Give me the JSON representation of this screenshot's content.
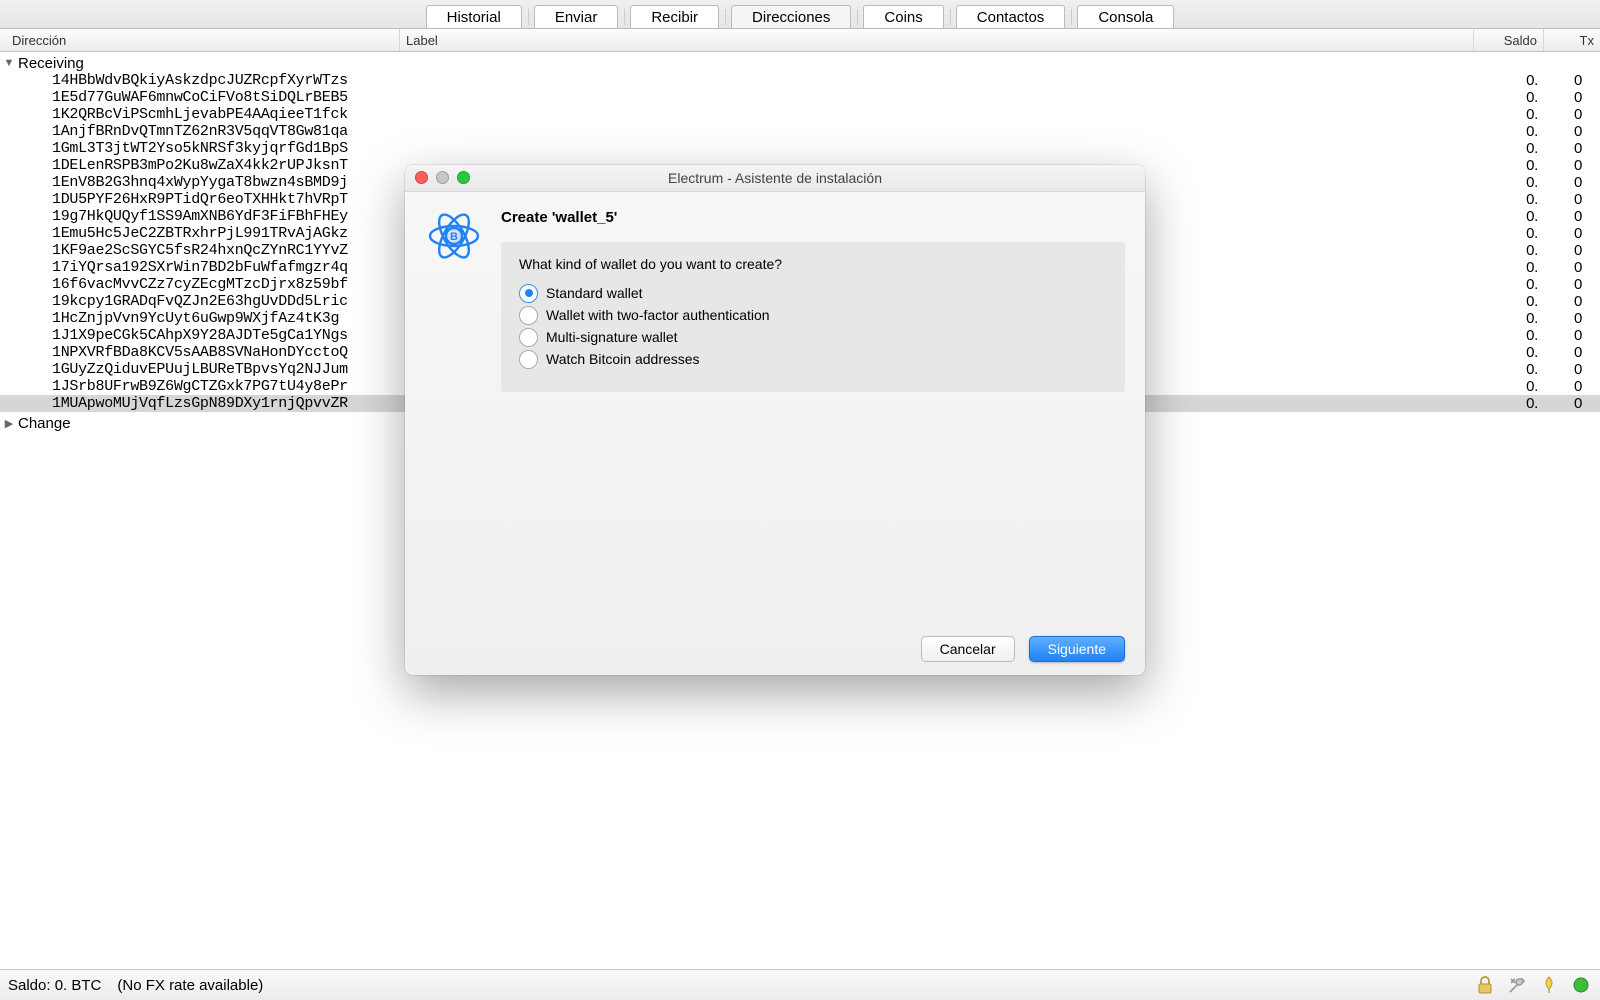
{
  "tabs": [
    "Historial",
    "Enviar",
    "Recibir",
    "Direcciones",
    "Coins",
    "Contactos",
    "Consola"
  ],
  "active_tab": 3,
  "columns": {
    "address": "Dirección",
    "label": "Label",
    "balance": "Saldo",
    "tx": "Tx"
  },
  "groups": [
    {
      "name": "Receiving",
      "expanded": true,
      "rows": [
        {
          "addr": "14HBbWdvBQkiyAskzdpcJUZRcpfXyrWTzs",
          "saldo": "0.",
          "tx": "0"
        },
        {
          "addr": "1E5d77GuWAF6mnwCoCiFVo8tSiDQLrBEB5",
          "saldo": "0.",
          "tx": "0"
        },
        {
          "addr": "1K2QRBcViPScmhLjevabPE4AAqieeT1fck",
          "saldo": "0.",
          "tx": "0"
        },
        {
          "addr": "1AnjfBRnDvQTmnTZ62nR3V5qqVT8Gw81qa",
          "saldo": "0.",
          "tx": "0"
        },
        {
          "addr": "1GmL3T3jtWT2Yso5kNRSf3kyjqrfGd1BpS",
          "saldo": "0.",
          "tx": "0"
        },
        {
          "addr": "1DELenRSPB3mPo2Ku8wZaX4kk2rUPJksnT",
          "saldo": "0.",
          "tx": "0"
        },
        {
          "addr": "1EnV8B2G3hnq4xWypYygaT8bwzn4sBMD9j",
          "saldo": "0.",
          "tx": "0"
        },
        {
          "addr": "1DU5PYF26HxR9PTidQr6eoTXHHkt7hVRpT",
          "saldo": "0.",
          "tx": "0"
        },
        {
          "addr": "19g7HkQUQyf1SS9AmXNB6YdF3FiFBhFHEy",
          "saldo": "0.",
          "tx": "0"
        },
        {
          "addr": "1Emu5Hc5JeC2ZBTRxhrPjL991TRvAjAGkz",
          "saldo": "0.",
          "tx": "0"
        },
        {
          "addr": "1KF9ae2ScSGYC5fsR24hxnQcZYnRC1YYvZ",
          "saldo": "0.",
          "tx": "0"
        },
        {
          "addr": "17iYQrsa192SXrWin7BD2bFuWfafmgzr4q",
          "saldo": "0.",
          "tx": "0"
        },
        {
          "addr": "16f6vacMvvCZz7cyZEcgMTzcDjrx8z59bf",
          "saldo": "0.",
          "tx": "0"
        },
        {
          "addr": "19kcpy1GRADqFvQZJn2E63hgUvDDd5Lric",
          "saldo": "0.",
          "tx": "0"
        },
        {
          "addr": "1HcZnjpVvn9YcUyt6uGwp9WXjfAz4tK3g",
          "saldo": "0.",
          "tx": "0"
        },
        {
          "addr": "1J1X9peCGk5CAhpX9Y28AJDTe5gCa1YNgs",
          "saldo": "0.",
          "tx": "0"
        },
        {
          "addr": "1NPXVRfBDa8KCV5sAAB8SVNaHonDYcctoQ",
          "saldo": "0.",
          "tx": "0"
        },
        {
          "addr": "1GUyZzQiduvEPUujLBUReTBpvsYq2NJJum",
          "saldo": "0.",
          "tx": "0"
        },
        {
          "addr": "1JSrb8UFrwB9Z6WgCTZGxk7PG7tU4y8ePr",
          "saldo": "0.",
          "tx": "0"
        },
        {
          "addr": "1MUApwoMUjVqfLzsGpN89DXy1rnjQpvvZR",
          "saldo": "0.",
          "tx": "0",
          "selected": true
        }
      ]
    },
    {
      "name": "Change",
      "expanded": false,
      "rows": []
    }
  ],
  "status": {
    "balance": "Saldo: 0. BTC",
    "fx": "(No FX rate available)"
  },
  "status_icons": [
    "lock-icon",
    "tools-icon",
    "seed-icon",
    "network-icon"
  ],
  "modal": {
    "title": "Electrum  -  Asistente de instalación",
    "heading": "Create 'wallet_5'",
    "question": "What kind of wallet do you want to create?",
    "options": [
      "Standard wallet",
      "Wallet with two-factor authentication",
      "Multi-signature wallet",
      "Watch Bitcoin addresses"
    ],
    "selected": 0,
    "cancel": "Cancelar",
    "next": "Siguiente"
  },
  "colors": {
    "accent": "#1f82f7"
  }
}
